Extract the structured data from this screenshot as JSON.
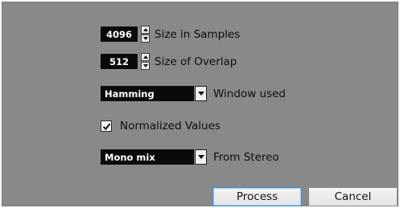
{
  "settings": {
    "size_in_samples": {
      "value": "4096",
      "label": "Size in Samples"
    },
    "size_of_overlap": {
      "value": "512",
      "label": "Size of Overlap"
    },
    "window_used": {
      "value": "Hamming",
      "label": "Window used"
    },
    "normalized_values": {
      "checked": true,
      "label": "Normalized Values"
    },
    "from_stereo": {
      "value": "Mono mix",
      "label": "From Stereo"
    }
  },
  "buttons": {
    "process_label": "Process",
    "cancel_label": "Cancel"
  },
  "icons": {
    "spin": "spinner-arrows-icon",
    "dropdown": "chevron-down-icon",
    "check": "checkmark-icon"
  }
}
